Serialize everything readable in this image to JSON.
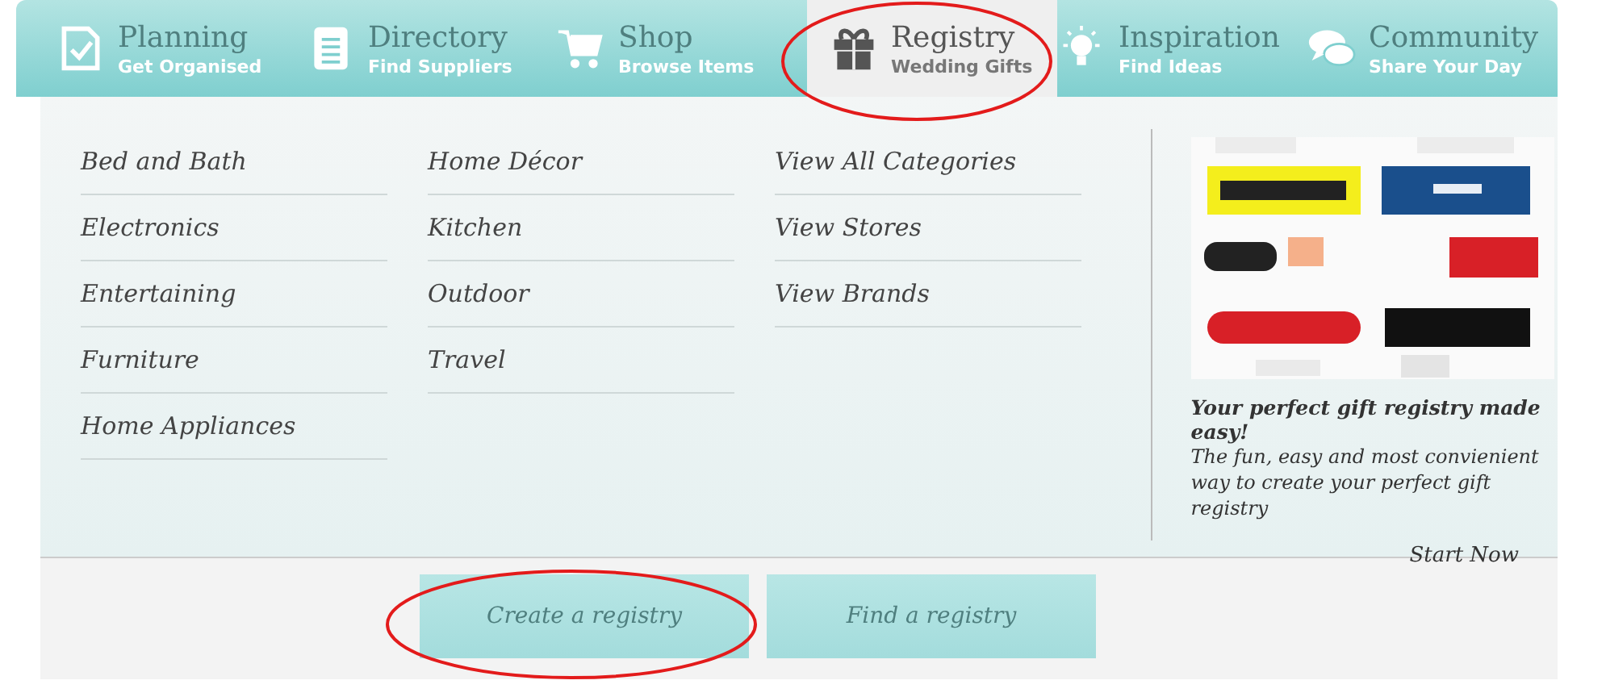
{
  "nav": [
    {
      "title": "Planning",
      "subtitle": "Get Organised",
      "kind": "checklist",
      "selected": false
    },
    {
      "title": "Directory",
      "subtitle": "Find Suppliers",
      "kind": "notebook",
      "selected": false
    },
    {
      "title": "Shop",
      "subtitle": "Browse Items",
      "kind": "cart",
      "selected": false
    },
    {
      "title": "Registry",
      "subtitle": "Wedding Gifts",
      "kind": "gift",
      "selected": true
    },
    {
      "title": "Inspiration",
      "subtitle": "Find Ideas",
      "kind": "bulb",
      "selected": false
    },
    {
      "title": "Community",
      "subtitle": "Share Your Day",
      "kind": "chat",
      "selected": false
    }
  ],
  "menu_columns": [
    [
      "Bed and Bath",
      "Electronics",
      "Entertaining",
      "Furniture",
      "Home Appliances"
    ],
    [
      "Home Décor",
      "Kitchen",
      "Outdoor",
      "Travel"
    ],
    [
      "View All Categories",
      "View Stores",
      "View Brands"
    ]
  ],
  "promo": {
    "headline": "Your perfect gift registry made easy!",
    "body": "The fun, easy and most convienient way to create your perfect gift registry",
    "link": "Start Now"
  },
  "buttons": [
    "Create a registry",
    "Find a registry"
  ]
}
